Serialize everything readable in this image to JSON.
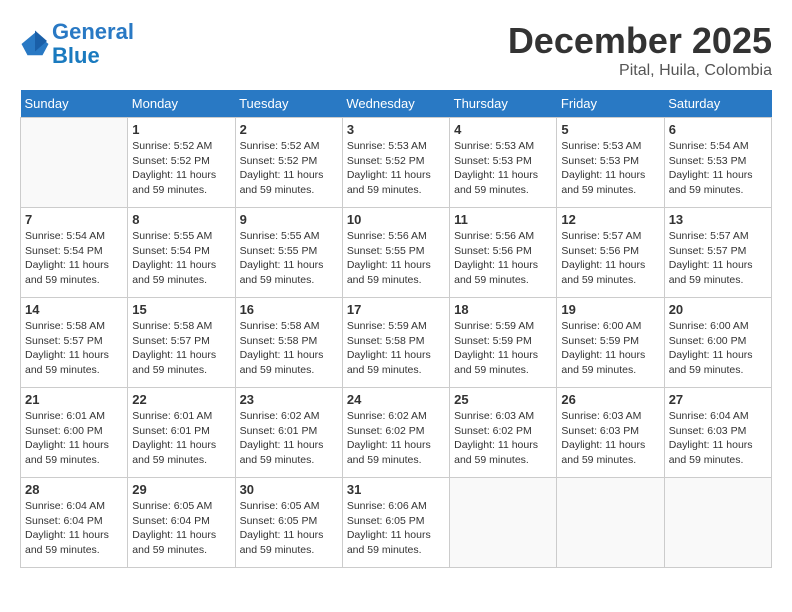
{
  "header": {
    "logo_line1": "General",
    "logo_line2": "Blue",
    "month": "December 2025",
    "location": "Pital, Huila, Colombia"
  },
  "weekdays": [
    "Sunday",
    "Monday",
    "Tuesday",
    "Wednesday",
    "Thursday",
    "Friday",
    "Saturday"
  ],
  "weeks": [
    [
      {
        "day": "",
        "sunrise": "",
        "sunset": "",
        "daylight": ""
      },
      {
        "day": "1",
        "sunrise": "Sunrise: 5:52 AM",
        "sunset": "Sunset: 5:52 PM",
        "daylight": "Daylight: 11 hours and 59 minutes."
      },
      {
        "day": "2",
        "sunrise": "Sunrise: 5:52 AM",
        "sunset": "Sunset: 5:52 PM",
        "daylight": "Daylight: 11 hours and 59 minutes."
      },
      {
        "day": "3",
        "sunrise": "Sunrise: 5:53 AM",
        "sunset": "Sunset: 5:52 PM",
        "daylight": "Daylight: 11 hours and 59 minutes."
      },
      {
        "day": "4",
        "sunrise": "Sunrise: 5:53 AM",
        "sunset": "Sunset: 5:53 PM",
        "daylight": "Daylight: 11 hours and 59 minutes."
      },
      {
        "day": "5",
        "sunrise": "Sunrise: 5:53 AM",
        "sunset": "Sunset: 5:53 PM",
        "daylight": "Daylight: 11 hours and 59 minutes."
      },
      {
        "day": "6",
        "sunrise": "Sunrise: 5:54 AM",
        "sunset": "Sunset: 5:53 PM",
        "daylight": "Daylight: 11 hours and 59 minutes."
      }
    ],
    [
      {
        "day": "7",
        "sunrise": "Sunrise: 5:54 AM",
        "sunset": "Sunset: 5:54 PM",
        "daylight": "Daylight: 11 hours and 59 minutes."
      },
      {
        "day": "8",
        "sunrise": "Sunrise: 5:55 AM",
        "sunset": "Sunset: 5:54 PM",
        "daylight": "Daylight: 11 hours and 59 minutes."
      },
      {
        "day": "9",
        "sunrise": "Sunrise: 5:55 AM",
        "sunset": "Sunset: 5:55 PM",
        "daylight": "Daylight: 11 hours and 59 minutes."
      },
      {
        "day": "10",
        "sunrise": "Sunrise: 5:56 AM",
        "sunset": "Sunset: 5:55 PM",
        "daylight": "Daylight: 11 hours and 59 minutes."
      },
      {
        "day": "11",
        "sunrise": "Sunrise: 5:56 AM",
        "sunset": "Sunset: 5:56 PM",
        "daylight": "Daylight: 11 hours and 59 minutes."
      },
      {
        "day": "12",
        "sunrise": "Sunrise: 5:57 AM",
        "sunset": "Sunset: 5:56 PM",
        "daylight": "Daylight: 11 hours and 59 minutes."
      },
      {
        "day": "13",
        "sunrise": "Sunrise: 5:57 AM",
        "sunset": "Sunset: 5:57 PM",
        "daylight": "Daylight: 11 hours and 59 minutes."
      }
    ],
    [
      {
        "day": "14",
        "sunrise": "Sunrise: 5:58 AM",
        "sunset": "Sunset: 5:57 PM",
        "daylight": "Daylight: 11 hours and 59 minutes."
      },
      {
        "day": "15",
        "sunrise": "Sunrise: 5:58 AM",
        "sunset": "Sunset: 5:57 PM",
        "daylight": "Daylight: 11 hours and 59 minutes."
      },
      {
        "day": "16",
        "sunrise": "Sunrise: 5:58 AM",
        "sunset": "Sunset: 5:58 PM",
        "daylight": "Daylight: 11 hours and 59 minutes."
      },
      {
        "day": "17",
        "sunrise": "Sunrise: 5:59 AM",
        "sunset": "Sunset: 5:58 PM",
        "daylight": "Daylight: 11 hours and 59 minutes."
      },
      {
        "day": "18",
        "sunrise": "Sunrise: 5:59 AM",
        "sunset": "Sunset: 5:59 PM",
        "daylight": "Daylight: 11 hours and 59 minutes."
      },
      {
        "day": "19",
        "sunrise": "Sunrise: 6:00 AM",
        "sunset": "Sunset: 5:59 PM",
        "daylight": "Daylight: 11 hours and 59 minutes."
      },
      {
        "day": "20",
        "sunrise": "Sunrise: 6:00 AM",
        "sunset": "Sunset: 6:00 PM",
        "daylight": "Daylight: 11 hours and 59 minutes."
      }
    ],
    [
      {
        "day": "21",
        "sunrise": "Sunrise: 6:01 AM",
        "sunset": "Sunset: 6:00 PM",
        "daylight": "Daylight: 11 hours and 59 minutes."
      },
      {
        "day": "22",
        "sunrise": "Sunrise: 6:01 AM",
        "sunset": "Sunset: 6:01 PM",
        "daylight": "Daylight: 11 hours and 59 minutes."
      },
      {
        "day": "23",
        "sunrise": "Sunrise: 6:02 AM",
        "sunset": "Sunset: 6:01 PM",
        "daylight": "Daylight: 11 hours and 59 minutes."
      },
      {
        "day": "24",
        "sunrise": "Sunrise: 6:02 AM",
        "sunset": "Sunset: 6:02 PM",
        "daylight": "Daylight: 11 hours and 59 minutes."
      },
      {
        "day": "25",
        "sunrise": "Sunrise: 6:03 AM",
        "sunset": "Sunset: 6:02 PM",
        "daylight": "Daylight: 11 hours and 59 minutes."
      },
      {
        "day": "26",
        "sunrise": "Sunrise: 6:03 AM",
        "sunset": "Sunset: 6:03 PM",
        "daylight": "Daylight: 11 hours and 59 minutes."
      },
      {
        "day": "27",
        "sunrise": "Sunrise: 6:04 AM",
        "sunset": "Sunset: 6:03 PM",
        "daylight": "Daylight: 11 hours and 59 minutes."
      }
    ],
    [
      {
        "day": "28",
        "sunrise": "Sunrise: 6:04 AM",
        "sunset": "Sunset: 6:04 PM",
        "daylight": "Daylight: 11 hours and 59 minutes."
      },
      {
        "day": "29",
        "sunrise": "Sunrise: 6:05 AM",
        "sunset": "Sunset: 6:04 PM",
        "daylight": "Daylight: 11 hours and 59 minutes."
      },
      {
        "day": "30",
        "sunrise": "Sunrise: 6:05 AM",
        "sunset": "Sunset: 6:05 PM",
        "daylight": "Daylight: 11 hours and 59 minutes."
      },
      {
        "day": "31",
        "sunrise": "Sunrise: 6:06 AM",
        "sunset": "Sunset: 6:05 PM",
        "daylight": "Daylight: 11 hours and 59 minutes."
      },
      {
        "day": "",
        "sunrise": "",
        "sunset": "",
        "daylight": ""
      },
      {
        "day": "",
        "sunrise": "",
        "sunset": "",
        "daylight": ""
      },
      {
        "day": "",
        "sunrise": "",
        "sunset": "",
        "daylight": ""
      }
    ]
  ]
}
